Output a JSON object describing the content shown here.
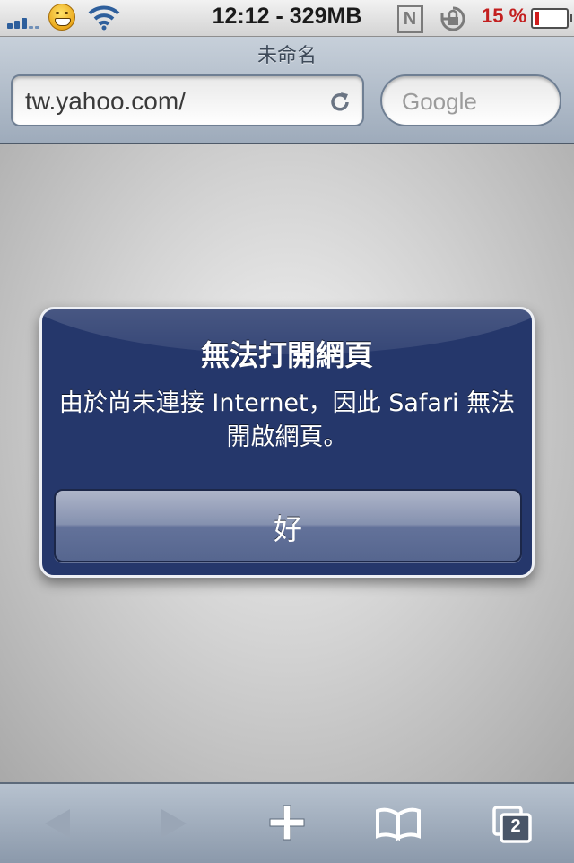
{
  "status_bar": {
    "time_memory": "12:12 - 329MB",
    "nav_indicator": "N",
    "battery_percent": "15 %",
    "battery_level": 0.15,
    "battery_color": "#d01c1c",
    "icons": [
      "signal-icon",
      "grinning-emoji-icon",
      "wifi-icon",
      "orientation-lock-icon",
      "battery-icon"
    ]
  },
  "address_bar": {
    "page_title": "未命名",
    "url": "tw.yahoo.com/",
    "search_placeholder": "Google",
    "icons": [
      "reload-icon"
    ]
  },
  "alert": {
    "title": "無法打開網頁",
    "message": "由於尚未連接 Internet，因此 Safari 無法開啟網頁。",
    "button_label": "好",
    "background_color": "#25376b"
  },
  "toolbar": {
    "tab_count": "2",
    "icons": [
      "back-arrow-icon",
      "forward-arrow-icon",
      "add-plus-icon",
      "bookmarks-book-icon",
      "tabs-pages-icon"
    ]
  }
}
